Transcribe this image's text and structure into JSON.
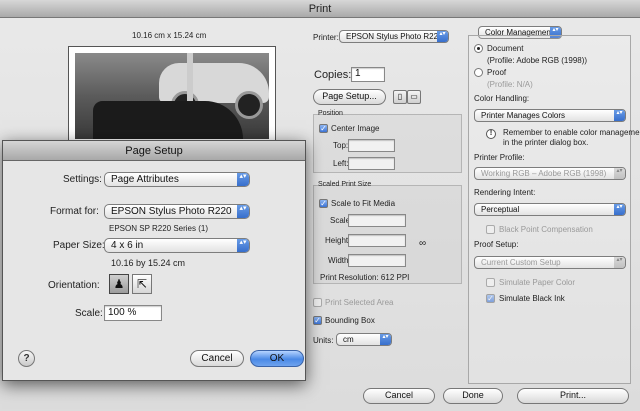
{
  "print_dialog": {
    "title": "Print",
    "preview_size_label": "10.16 cm x 15.24 cm",
    "printer_label": "Printer:",
    "printer_value": "EPSON Stylus Photo R220",
    "copies_label": "Copies:",
    "copies_value": "1",
    "page_setup_button": "Page Setup...",
    "position": {
      "title": "Position",
      "center_image_label": "Center Image",
      "center_image_checked": true,
      "top_label": "Top:",
      "left_label": "Left:"
    },
    "scaled_print_size": {
      "title": "Scaled Print Size",
      "scale_to_fit_label": "Scale to Fit Media",
      "scale_to_fit_checked": true,
      "scale_label": "Scale:",
      "height_label": "Height:",
      "width_label": "Width:",
      "print_resolution": "Print Resolution: 612 PPI"
    },
    "print_selected_area_label": "Print Selected Area",
    "bounding_box_label": "Bounding Box",
    "units_label": "Units:",
    "units_value": "cm",
    "color_management": {
      "dropdown_value": "Color Management",
      "document_label": "Document",
      "document_profile": "(Profile: Adobe RGB (1998))",
      "proof_label": "Proof",
      "proof_profile": "(Profile: N/A)",
      "color_handling_label": "Color Handling:",
      "color_handling_value": "Printer Manages Colors",
      "reminder_text_1": "Remember to enable color management",
      "reminder_text_2": "in the printer dialog box.",
      "printer_profile_label": "Printer Profile:",
      "printer_profile_value": "Working RGB – Adobe RGB (1998)",
      "rendering_intent_label": "Rendering Intent:",
      "rendering_intent_value": "Perceptual",
      "black_point_label": "Black Point Compensation",
      "proof_setup_label": "Proof Setup:",
      "proof_setup_value": "Current Custom Setup",
      "simulate_paper_label": "Simulate Paper Color",
      "simulate_ink_label": "Simulate Black Ink"
    },
    "cancel_button": "Cancel",
    "done_button": "Done",
    "print_button": "Print..."
  },
  "page_setup": {
    "title": "Page Setup",
    "settings_label": "Settings:",
    "settings_value": "Page Attributes",
    "format_for_label": "Format for:",
    "format_for_value": "EPSON Stylus Photo R220",
    "format_for_sub": "EPSON SP R220 Series (1)",
    "paper_size_label": "Paper Size:",
    "paper_size_value": "4 x 6 in",
    "paper_size_sub": "10.16 by 15.24 cm",
    "orientation_label": "Orientation:",
    "scale_label": "Scale:",
    "scale_value": "100 %",
    "help_glyph": "?",
    "cancel_button": "Cancel",
    "ok_button": "OK"
  }
}
